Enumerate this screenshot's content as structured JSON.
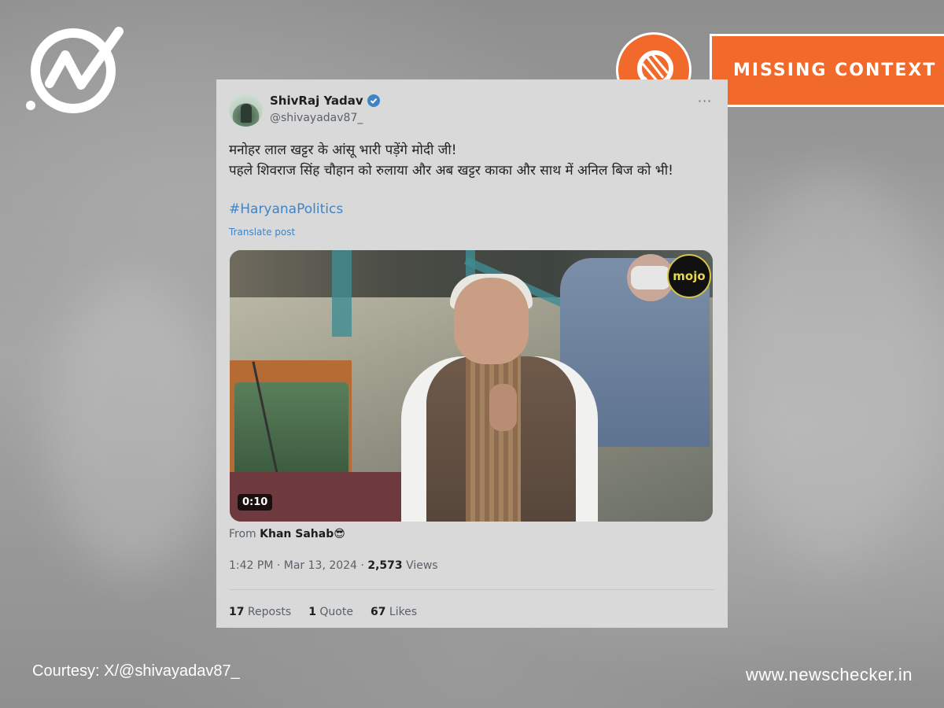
{
  "tweet": {
    "display_name": "ShivRaj Yadav",
    "handle": "@shivayadav87_",
    "text_line1": "मनोहर लाल खट्टर के आंसू भारी पड़ेंगे मोदी जी!",
    "text_line2": "पहले शिवराज सिंह चौहान को रुलाया और अब खट्टर काका और साथ में अनिल बिज को भी!",
    "hashtag": "#HaryanaPolitics",
    "translate": "Translate post",
    "video_time": "0:10",
    "watermark": "mojo",
    "from_label": "From",
    "from_name": "Khan Sahab😎",
    "timestamp": "1:42 PM · Mar 13, 2024 · ",
    "views_count": "2,573",
    "views_label": " Views",
    "reposts_count": "17",
    "reposts_label": " Reposts",
    "quotes_count": "1",
    "quotes_label": " Quote",
    "likes_count": "67",
    "likes_label": " Likes",
    "more": "···"
  },
  "label": {
    "text": "MISSING CONTEXT"
  },
  "footer": {
    "courtesy": "Courtesy: X/@shivayadav87_",
    "site": "www.newschecker.in"
  },
  "colors": {
    "accent": "#f26a2b",
    "link": "#3f84c4"
  },
  "icons": [
    "newschecker-logo-icon",
    "magnifier-icon",
    "verified-badge-icon"
  ]
}
